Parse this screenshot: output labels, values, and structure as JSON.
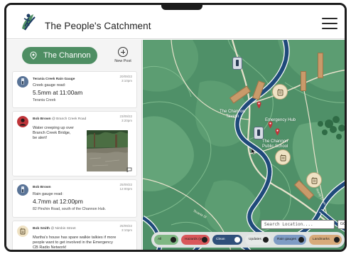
{
  "app": {
    "title": "The People's Catchment"
  },
  "sidebar": {
    "catchment_label": "The Channon",
    "new_post_label": "New Post",
    "posts": [
      {
        "author": "Terania Creek Rain Gauge",
        "date": "20/09/22",
        "time": "3:10pm",
        "lead": "Creek gauge read:",
        "reading": "5.5mm at 11:00am",
        "place": "Terania Creek"
      },
      {
        "author": "Bob Brown",
        "location": "@ Branch Creek Road",
        "date": "23/09/22",
        "time": "3:20pm",
        "body": [
          "Water creeping up over",
          "Branch Creek Bridge,",
          "be alert!"
        ]
      },
      {
        "author": "Bob Brown",
        "date": "25/09/22",
        "time": "12:00pm",
        "lead": "Rain gauge read:",
        "reading": "4.7mm at 12:00pm",
        "place": "82 Pinchin Road, south of the Channon Hub."
      },
      {
        "author": "Bob Smith",
        "location": "@ Nimbin Street",
        "date": "25/09/22",
        "time": "3:10pm",
        "body": [
          "Martha's house has spare walkie talkies if more",
          "people want to get involved in the Emergency",
          "CB Radio Network!"
        ]
      }
    ]
  },
  "map": {
    "labels": {
      "tavern": [
        "The Channon",
        "Tavern"
      ],
      "hub": "Emergency Hub",
      "school": [
        "The Channon",
        "Public School"
      ]
    },
    "roads": {
      "terania": "Terania St",
      "rocky": "Rocky Creek"
    },
    "search_placeholder": "Search Location....",
    "search_button": "GO",
    "filters": [
      {
        "label": "All",
        "color": "#7fb783"
      },
      {
        "label": "Hazards (on)",
        "color": "#d8575a"
      },
      {
        "label": "Clean",
        "color": "#2f4f7a"
      },
      {
        "label": "Updates",
        "color": "#e6e9e8"
      },
      {
        "label": "Rain gauges",
        "color": "#7e9bc4"
      },
      {
        "label": "Landmarks",
        "color": "#d8aa7a"
      }
    ]
  },
  "colors": {
    "accent": "#4e8e63",
    "map_green": "#4a8a63",
    "river": "#1f4a7a",
    "road": "#e8e2cc",
    "landmark": "#c99a6a",
    "hazard_red": "#c0353a"
  }
}
